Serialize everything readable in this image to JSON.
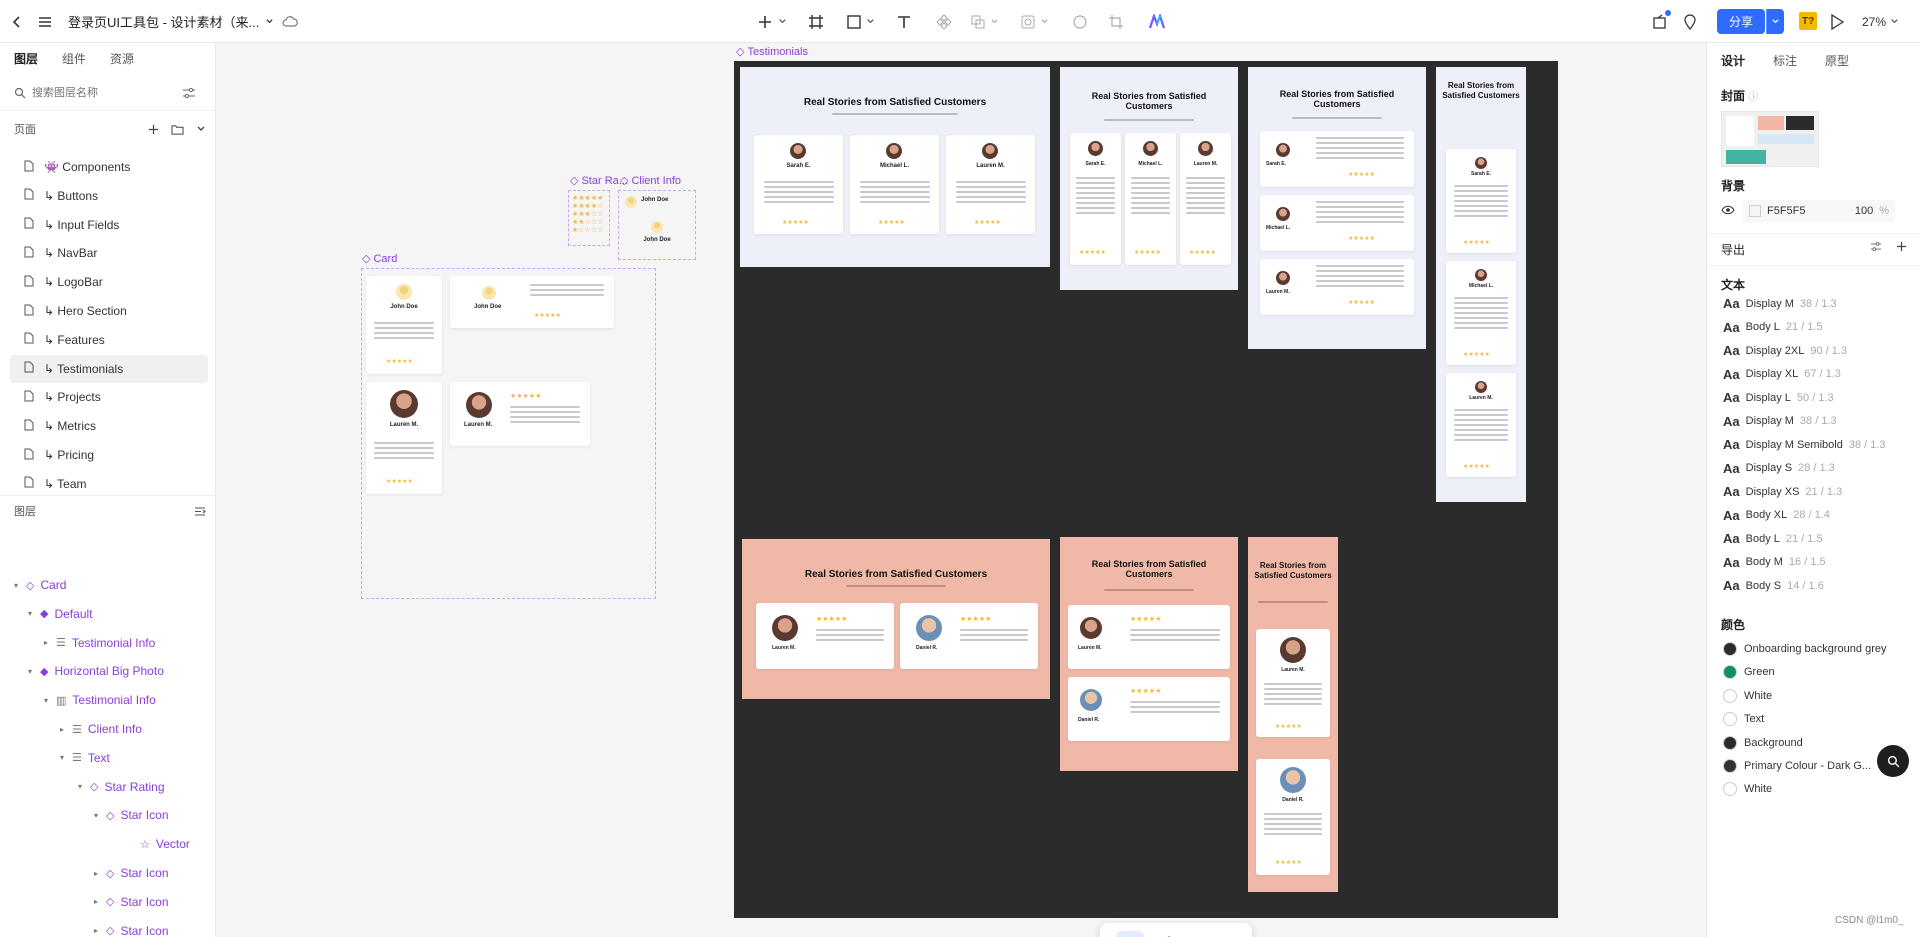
{
  "topbar": {
    "title": "登录页UI工具包 - 设计素材（来...",
    "share_label": "分享",
    "zoom": "27%",
    "badge": "T?"
  },
  "left_panel": {
    "tabs": [
      "图层",
      "组件",
      "资源"
    ],
    "search_placeholder": "搜索图层名称",
    "pages_label": "页面",
    "pages": [
      "👾 Components",
      "↳ Buttons",
      "↳ Input Fields",
      "↳ NavBar",
      "↳ LogoBar",
      "↳ Hero Section",
      "↳ Features",
      "↳ Testimonials",
      "↳ Projects",
      "↳ Metrics",
      "↳ Pricing",
      "↳ Team"
    ],
    "layers_label": "图层",
    "layers": [
      "Card",
      "Default",
      "Testimonial Info",
      "Horizontal Big Photo",
      "Testimonial Info",
      "Client Info",
      "Text",
      "Star Rating",
      "Star Icon",
      "Vector",
      "Star Icon",
      "Star Icon",
      "Star Icon",
      "Star Icon"
    ]
  },
  "canvas": {
    "frame_testimonials": "Testimonials",
    "frame_card": "Card",
    "frame_star": "Star Ra...",
    "frame_client": "Client Info",
    "board_title": "Real Stories from Satisfied Customers",
    "names": [
      "Sarah E.",
      "Michael L.",
      "Lauren M.",
      "Daniel R."
    ],
    "john": "John Doe",
    "lauren": "Lauren M.",
    "stars": "★★★★★"
  },
  "right_panel": {
    "tabs": [
      "设计",
      "标注",
      "原型"
    ],
    "cover_label": "封面",
    "bg_label": "背景",
    "bg_hex": "F5F5F5",
    "bg_opacity": "100",
    "bg_pct": "%",
    "export_label": "导出",
    "text_label": "文本",
    "text_styles": [
      {
        "name": "Display M",
        "meta": "38 / 1.3"
      },
      {
        "name": "Body L",
        "meta": "21 / 1.5"
      },
      {
        "name": "Display 2XL",
        "meta": "90 / 1.3"
      },
      {
        "name": "Display XL",
        "meta": "67 / 1.3"
      },
      {
        "name": "Display L",
        "meta": "50 / 1.3"
      },
      {
        "name": "Display M",
        "meta": "38 / 1.3"
      },
      {
        "name": "Display M Semibold",
        "meta": "38 / 1.3"
      },
      {
        "name": "Display S",
        "meta": "28 / 1.3"
      },
      {
        "name": "Display XS",
        "meta": "21 / 1.3"
      },
      {
        "name": "Body XL",
        "meta": "28 / 1.4"
      },
      {
        "name": "Body L",
        "meta": "21 / 1.5"
      },
      {
        "name": "Body M",
        "meta": "16 / 1.5"
      },
      {
        "name": "Body S",
        "meta": "14 / 1.6"
      }
    ],
    "colors_label": "颜色",
    "colors": [
      {
        "name": "Onboarding background grey",
        "hex": "#2b2b2b"
      },
      {
        "name": "Green",
        "hex": "#0f8f6b"
      },
      {
        "name": "White",
        "hex": "#ffffff"
      },
      {
        "name": "Text",
        "hex": "#ffffff"
      },
      {
        "name": "Background",
        "hex": "#2b2b2b"
      },
      {
        "name": "Primary Colour - Dark G...",
        "hex": "#333333"
      },
      {
        "name": "White",
        "hex": "#ffffff"
      }
    ],
    "watermark": "CSDN @l1m0_"
  }
}
